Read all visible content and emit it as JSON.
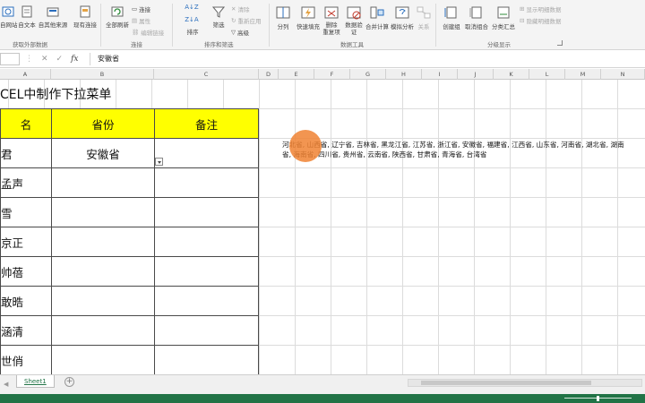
{
  "ribbon": {
    "get_data": {
      "from_web": "自网站",
      "from_text": "自文本",
      "from_other": "自其他来源",
      "existing": "现有连接",
      "group_label": "获取外部数据"
    },
    "connections": {
      "refresh_all": "全部刷新",
      "connections": "连接",
      "properties": "属性",
      "edit_links": "编辑链接",
      "group_label": "连接"
    },
    "sort_filter": {
      "sort": "排序",
      "filter": "筛选",
      "clear": "清除",
      "reapply": "重新应用",
      "advanced": "高级",
      "group_label": "排序和筛选"
    },
    "data_tools": {
      "split": "分列",
      "flash_fill": "快速填充",
      "remove_dup": "删除\n重复项",
      "validation": "数据验\n证",
      "consolidate": "合并计算",
      "what_if": "模拟分析",
      "relations": "关系",
      "group_label": "数据工具"
    },
    "outline": {
      "group": "创建组",
      "ungroup": "取消组合",
      "subtotal": "分类汇总",
      "show_detail": "显示明细数据",
      "hide_detail": "隐藏明细数据",
      "group_label": "分级显示"
    }
  },
  "formula_bar": {
    "value": "安徽省",
    "fx": "fx"
  },
  "columns": [
    "A",
    "B",
    "C",
    "D",
    "E",
    "F",
    "G",
    "H",
    "I",
    "J",
    "K",
    "L",
    "M",
    "N"
  ],
  "sheet": {
    "title": "CEL中制作下拉菜单",
    "headers": [
      "名",
      "省份",
      "备注"
    ],
    "rows": [
      {
        "name": "君",
        "province": "安徽省",
        "note": ""
      },
      {
        "name": "孟声",
        "province": "",
        "note": ""
      },
      {
        "name": "雪",
        "province": "",
        "note": ""
      },
      {
        "name": "京正",
        "province": "",
        "note": ""
      },
      {
        "name": "帅蓓",
        "province": "",
        "note": ""
      },
      {
        "name": "敢晧",
        "province": "",
        "note": ""
      },
      {
        "name": "涵清",
        "province": "",
        "note": ""
      },
      {
        "name": "世俏",
        "province": "",
        "note": ""
      }
    ],
    "province_list_line1": "河北省, 山西省, 辽宁省, 吉林省, 黑龙江省, 江苏省, 浙江省, 安徽省, 福建省, 江西省, 山东省, 河南省, 湖北省, 湖南",
    "province_list_line2": "省, 海南省, 四川省, 贵州省, 云南省, 陕西省, 甘肃省, 青海省, 台湾省"
  },
  "tabs": {
    "sheet1": "Sheet1",
    "add": "+"
  },
  "colors": {
    "header_fill": "#ffff00",
    "excel_green": "#217346",
    "cursor_highlight": "#f08232"
  }
}
